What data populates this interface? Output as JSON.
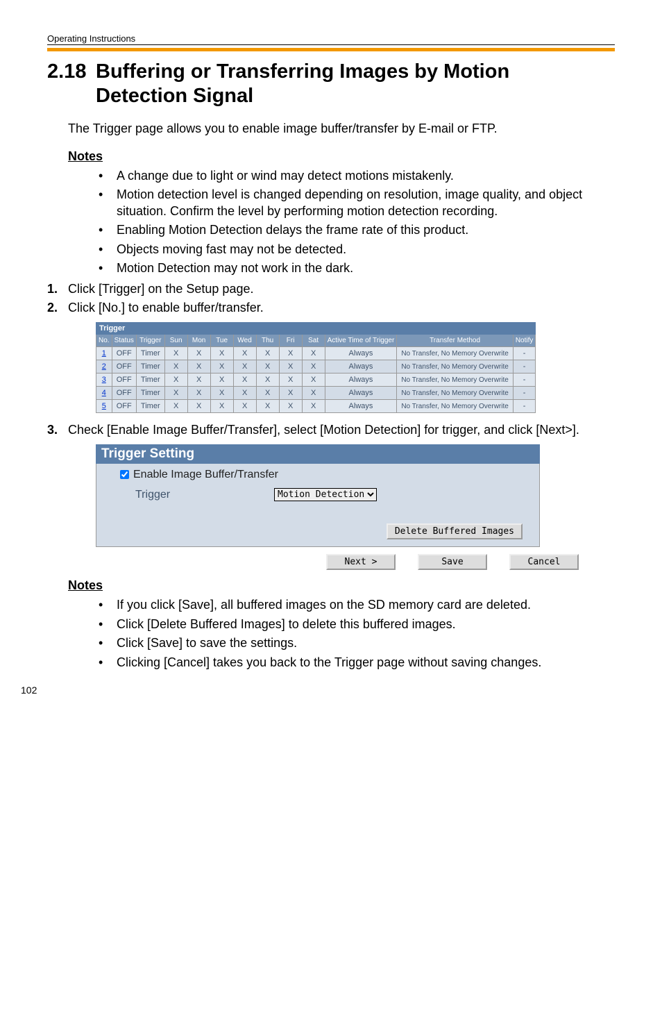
{
  "header": "Operating Instructions",
  "section_number": "2.18",
  "section_title": "Buffering or Transferring Images by Motion Detection Signal",
  "intro": "The Trigger page allows you to enable image buffer/transfer by E-mail or FTP.",
  "notes1_heading": "Notes",
  "notes1": [
    "A change due to light or wind may detect motions mistakenly.",
    "Motion detection level is changed depending on resolution, image quality, and object situation. Confirm the level by performing motion detection recording.",
    "Enabling Motion Detection delays the frame rate of this product.",
    "Objects moving fast may not be detected.",
    "Motion Detection may not work in the dark."
  ],
  "steps": {
    "s1_num": "1.",
    "s1_text": "Click [Trigger] on the Setup page.",
    "s2_num": "2.",
    "s2_text": "Click [No.] to enable buffer/transfer.",
    "s3_num": "3.",
    "s3_text": "Check [Enable Image Buffer/Transfer], select [Motion Detection] for trigger, and click [Next>]."
  },
  "trigger_table": {
    "title": "Trigger",
    "headers": [
      "No.",
      "Status",
      "Trigger",
      "Sun",
      "Mon",
      "Tue",
      "Wed",
      "Thu",
      "Fri",
      "Sat",
      "Active Time of Trigger",
      "Transfer Method",
      "Notify"
    ],
    "rows": [
      {
        "no": "1",
        "status": "OFF",
        "trigger": "Timer",
        "days": [
          "X",
          "X",
          "X",
          "X",
          "X",
          "X",
          "X"
        ],
        "active": "Always",
        "method": "No Transfer, No Memory Overwrite",
        "notify": "-"
      },
      {
        "no": "2",
        "status": "OFF",
        "trigger": "Timer",
        "days": [
          "X",
          "X",
          "X",
          "X",
          "X",
          "X",
          "X"
        ],
        "active": "Always",
        "method": "No Transfer, No Memory Overwrite",
        "notify": "-"
      },
      {
        "no": "3",
        "status": "OFF",
        "trigger": "Timer",
        "days": [
          "X",
          "X",
          "X",
          "X",
          "X",
          "X",
          "X"
        ],
        "active": "Always",
        "method": "No Transfer, No Memory Overwrite",
        "notify": "-"
      },
      {
        "no": "4",
        "status": "OFF",
        "trigger": "Timer",
        "days": [
          "X",
          "X",
          "X",
          "X",
          "X",
          "X",
          "X"
        ],
        "active": "Always",
        "method": "No Transfer, No Memory Overwrite",
        "notify": "-"
      },
      {
        "no": "5",
        "status": "OFF",
        "trigger": "Timer",
        "days": [
          "X",
          "X",
          "X",
          "X",
          "X",
          "X",
          "X"
        ],
        "active": "Always",
        "method": "No Transfer, No Memory Overwrite",
        "notify": "-"
      }
    ]
  },
  "setting_panel": {
    "title": "Trigger Setting",
    "checkbox_label": "Enable Image Buffer/Transfer",
    "trigger_label": "Trigger",
    "trigger_value": "Motion Detection",
    "delete_btn": "Delete Buffered Images",
    "next_btn": "Next >",
    "save_btn": "Save",
    "cancel_btn": "Cancel"
  },
  "notes2_heading": "Notes",
  "notes2": [
    "If you click [Save], all buffered images on the SD memory card are deleted.",
    "Click [Delete Buffered Images] to delete this buffered images.",
    "Click [Save] to save the settings.",
    "Clicking [Cancel] takes you back to the Trigger page without saving changes."
  ],
  "page_number": "102"
}
